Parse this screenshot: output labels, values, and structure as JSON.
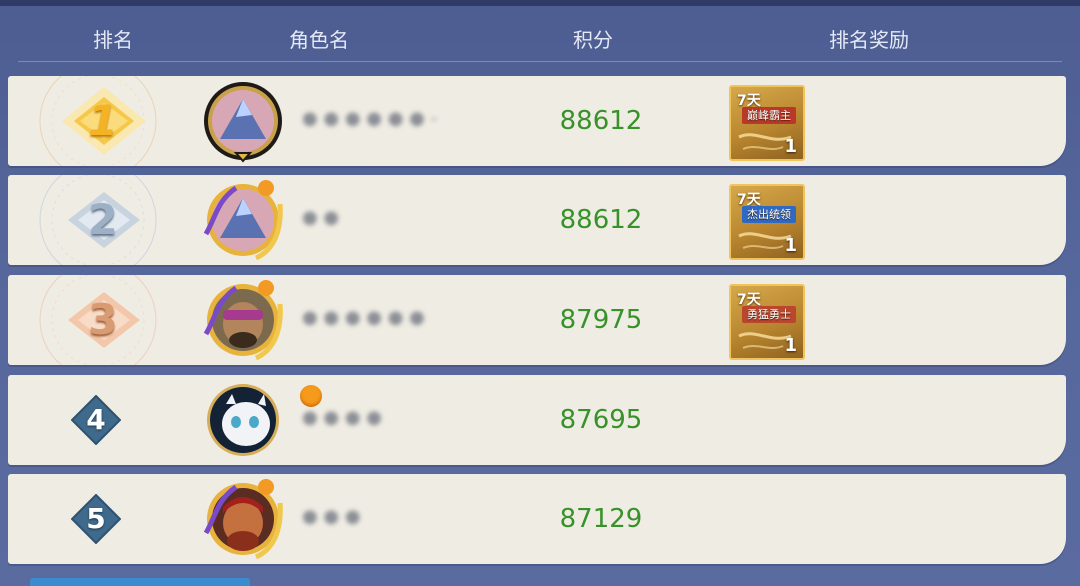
{
  "header": {
    "rank": "排名",
    "name": "角色名",
    "score": "积分",
    "reward": "排名奖励"
  },
  "rows": [
    {
      "rank": "1",
      "name": "● ● ● ● ● ● -",
      "score": "88612",
      "online": false,
      "reward": {
        "days": "7天",
        "title": "巅峰霸主",
        "count": "1",
        "banner_color": "#b9382a"
      }
    },
    {
      "rank": "2",
      "name": "● ●",
      "score": "88612",
      "online": false,
      "reward": {
        "days": "7天",
        "title": "杰出统领",
        "count": "1",
        "banner_color": "#2f69c2"
      }
    },
    {
      "rank": "3",
      "name": "● ● ● ● ● ●",
      "score": "87975",
      "online": false,
      "reward": {
        "days": "7天",
        "title": "勇猛勇士",
        "count": "1",
        "banner_color": "#b9462d"
      }
    },
    {
      "rank": "4",
      "name": "● ● ● ●",
      "score": "87695",
      "online": true
    },
    {
      "rank": "5",
      "name": "● ● ●",
      "score": "87129",
      "online": false
    }
  ],
  "colors": {
    "background": "#55669b",
    "row": "#efece3",
    "score": "#38922a",
    "rank_diamond": "#3f6a8c",
    "online_dot": "#f59a1b",
    "gold": "#f0b52b",
    "silver": "#b9c6d6",
    "bronze": "#e3a780"
  }
}
